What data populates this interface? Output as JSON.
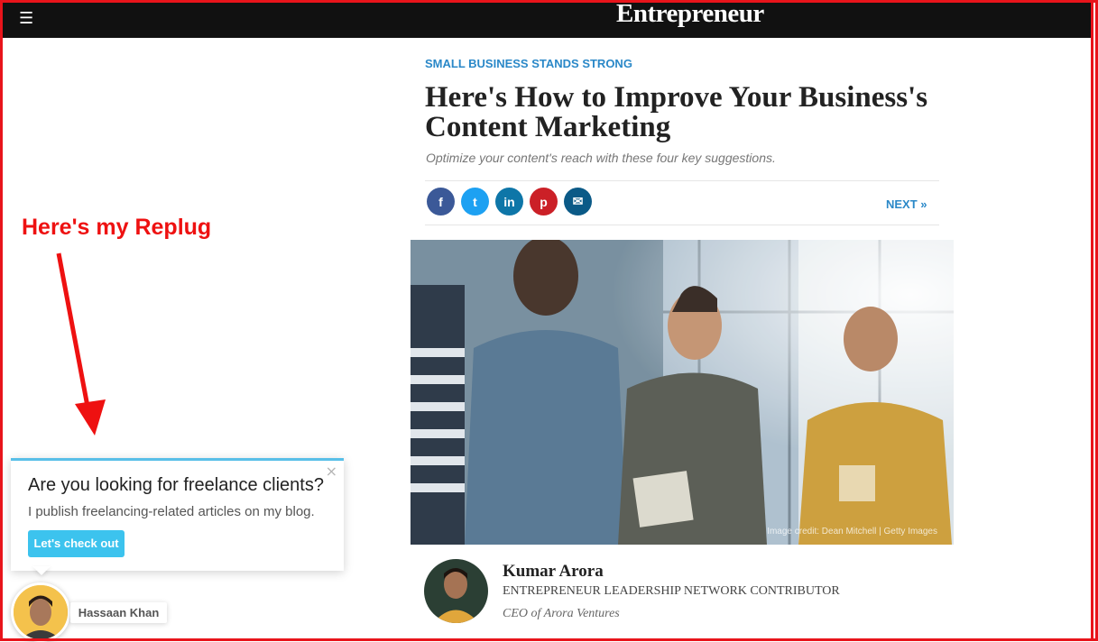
{
  "site": {
    "brand": "Entrepreneur",
    "menu_icon": "hamburger-icon"
  },
  "article": {
    "kicker": "SMALL BUSINESS STANDS STRONG",
    "title": "Here's How to Improve Your Business's Content Marketing",
    "subtitle": "Optimize your content's reach with these four key suggestions.",
    "next_label": "NEXT »",
    "image_credit": "Image credit: Dean Mitchell | Getty Images",
    "share_buttons": [
      {
        "icon": "facebook-icon",
        "glyph": "f",
        "color": "#3b5998"
      },
      {
        "icon": "twitter-icon",
        "glyph": "t",
        "color": "#1da1f2"
      },
      {
        "icon": "linkedin-icon",
        "glyph": "in",
        "color": "#0e76a8"
      },
      {
        "icon": "pinterest-icon",
        "glyph": "p",
        "color": "#cb2027"
      },
      {
        "icon": "email-icon",
        "glyph": "✉",
        "color": "#0b5a87"
      }
    ]
  },
  "author": {
    "name": "Kumar Arora",
    "role": "ENTREPRENEUR LEADERSHIP NETWORK CONTRIBUTOR",
    "bio": "CEO of Arora Ventures"
  },
  "annotation": {
    "text": "Here's my Replug",
    "color": "#ee1111"
  },
  "replug_popup": {
    "title": "Are you looking for freelance clients?",
    "message": "I publish freelancing-related articles on my blog.",
    "button_label": "Let's check out",
    "close_symbol": "×",
    "sender_name": "Hassaan Khan",
    "accent_color": "#58bfe8",
    "button_color": "#3cc3ee"
  }
}
